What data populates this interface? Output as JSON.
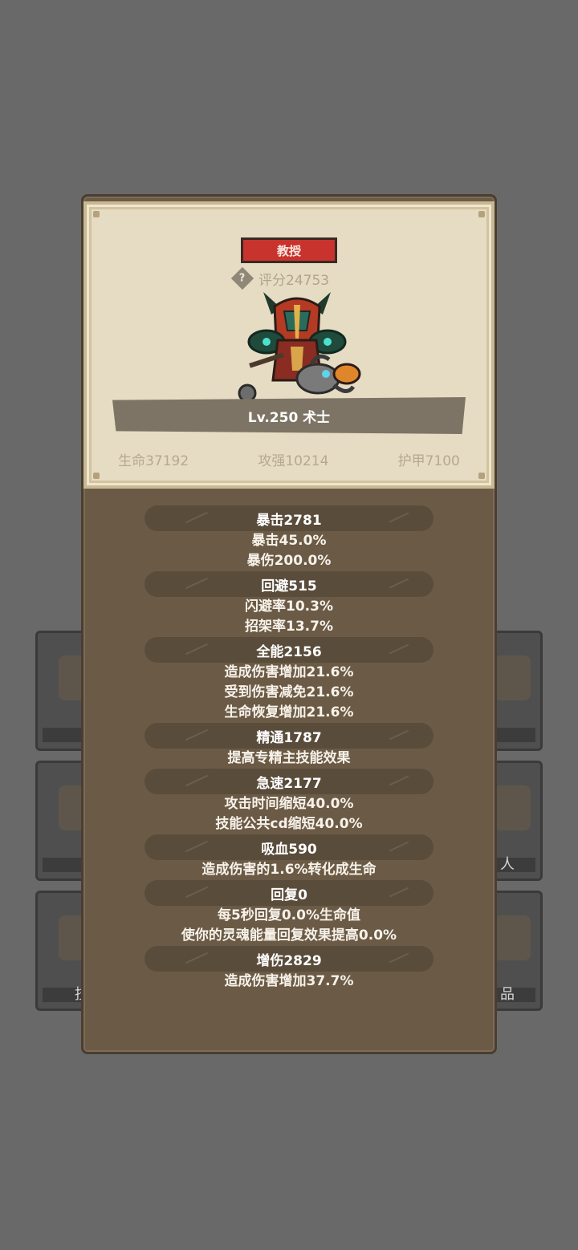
{
  "background_slots_text": {
    "left_bottom": "技",
    "right_mid": "人",
    "right_bottom": "品"
  },
  "profile": {
    "title_badge": "教授",
    "score_label": "评分24753",
    "level_class": "Lv.250 术士",
    "base_stats": [
      "生命37192",
      "攻强10214",
      "护甲7100"
    ]
  },
  "stat_sections": [
    {
      "header": "暴击2781",
      "lines": [
        "暴击45.0%",
        "暴伤200.0%"
      ]
    },
    {
      "header": "回避515",
      "lines": [
        "闪避率10.3%",
        "招架率13.7%"
      ]
    },
    {
      "header": "全能2156",
      "lines": [
        "造成伤害增加21.6%",
        "受到伤害减免21.6%",
        "生命恢复增加21.6%"
      ]
    },
    {
      "header": "精通1787",
      "lines": [
        "提高专精主技能效果"
      ]
    },
    {
      "header": "急速2177",
      "lines": [
        "攻击时间缩短40.0%",
        "技能公共cd缩短40.0%"
      ]
    },
    {
      "header": "吸血590",
      "lines": [
        "造成伤害的1.6%转化成生命"
      ]
    },
    {
      "header": "回复0",
      "lines": [
        "每5秒回复0.0%生命值",
        "使你的灵魂能量回复效果提高0.0%"
      ]
    },
    {
      "header": "增伤2829",
      "lines": [
        "造成伤害增加37.7%"
      ]
    }
  ],
  "colors": {
    "badge_red": "#c8332e",
    "card_parchment": "#e6dcc3",
    "panel_brown": "#6b5b46"
  }
}
